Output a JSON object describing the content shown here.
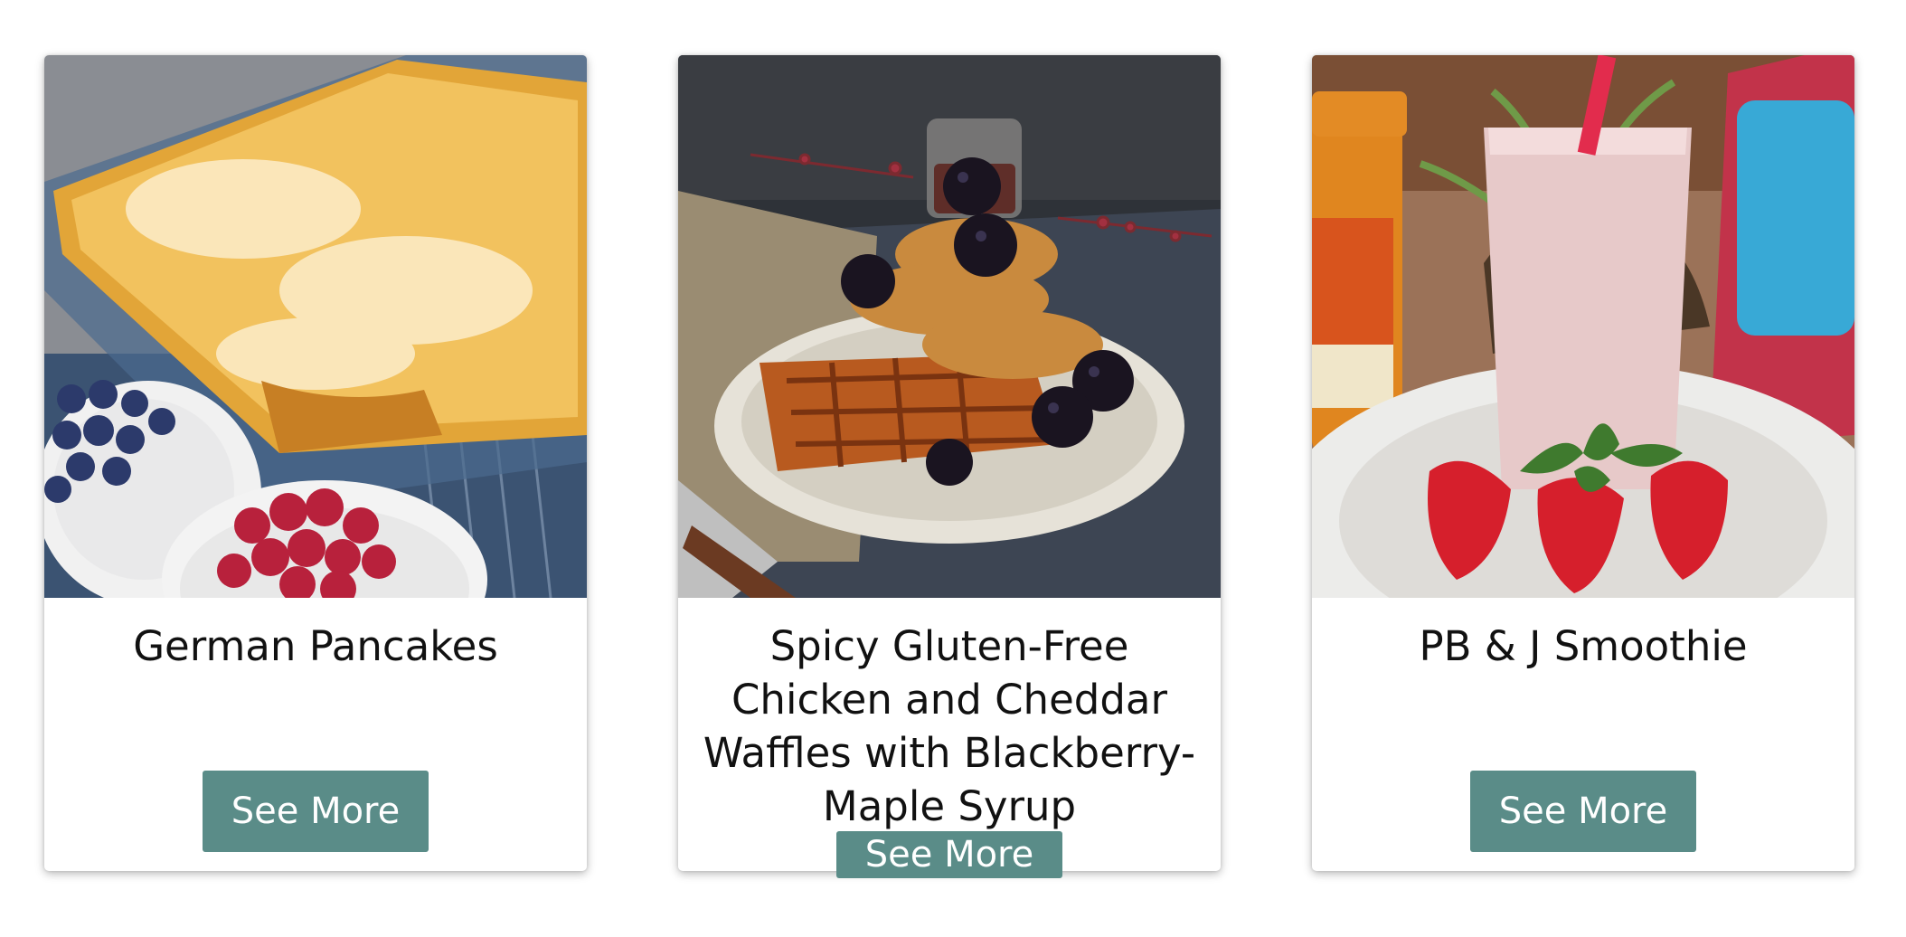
{
  "cards": [
    {
      "title": "German Pancakes",
      "button_label": "See More",
      "image_icon": "german-pancakes-photo"
    },
    {
      "title": "Spicy Gluten-Free Chicken and Cheddar Waffles with Blackberry-Maple Syrup",
      "button_label": "See More",
      "image_icon": "chicken-waffles-photo"
    },
    {
      "title": "PB & J Smoothie",
      "button_label": "See More",
      "image_icon": "pbj-smoothie-photo"
    }
  ],
  "colors": {
    "button_bg": "#5a8c88",
    "button_text": "#ffffff",
    "title_text": "#111111",
    "card_bg": "#ffffff"
  }
}
